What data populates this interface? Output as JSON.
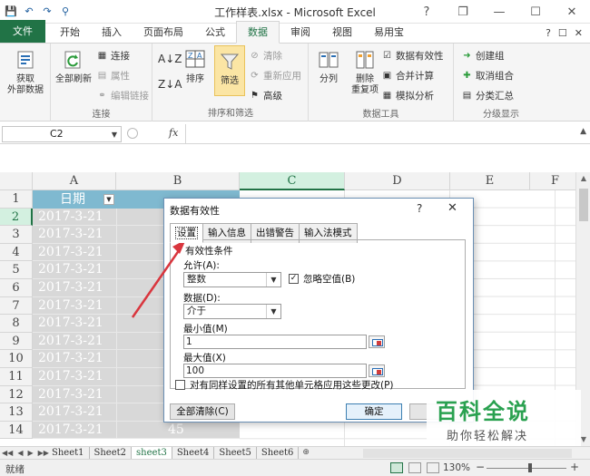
{
  "window": {
    "title": "工作样表.xlsx - Microsoft Excel",
    "qat": {
      "save": "💾",
      "undo": "↶",
      "redo": "↷",
      "custom": "⚲"
    },
    "controls": {
      "help": "?",
      "restore": "❐",
      "minimize": "—",
      "maximize": "☐",
      "close": "✕"
    }
  },
  "tabs": {
    "file": "文件",
    "items": [
      "开始",
      "插入",
      "页面布局",
      "公式",
      "数据",
      "审阅",
      "视图",
      "易用宝"
    ],
    "active": "数据",
    "right_icons": [
      "?",
      "☐",
      "✕"
    ]
  },
  "ribbon": {
    "get_external": {
      "label1": "获取",
      "label2": "外部数据"
    },
    "connections": {
      "refresh_all": "全部刷新",
      "connect": "连接",
      "properties": "属性",
      "edit_links": "编辑链接",
      "group": "连接"
    },
    "sort_filter": {
      "sort": "排序",
      "filter": "筛选",
      "clear": "清除",
      "reapply": "重新应用",
      "advanced": "高级",
      "group": "排序和筛选"
    },
    "data_tools": {
      "text_to_columns": "分列",
      "remove": "删除",
      "remove2": "重复项",
      "validation": "数据有效性",
      "consolidate": "合并计算",
      "whatif": "模拟分析",
      "group": "数据工具"
    },
    "outline": {
      "group_btn": "创建组",
      "ungroup": "取消组合",
      "subtotal": "分类汇总",
      "group": "分级显示"
    }
  },
  "formula_bar": {
    "name_box": "C2",
    "fx": "fx",
    "value": ""
  },
  "grid": {
    "columns": [
      "A",
      "B",
      "C",
      "D",
      "E",
      "F"
    ],
    "selected_column": "C",
    "rows": [
      "1",
      "2",
      "3",
      "4",
      "5",
      "6",
      "7",
      "8",
      "9",
      "10",
      "11",
      "12",
      "13",
      "14"
    ],
    "selected_row": "2",
    "header_a": "日期",
    "dates": [
      "2017-3-21",
      "2017-3-21",
      "2017-3-21",
      "2017-3-21",
      "2017-3-21",
      "2017-3-21",
      "2017-3-21",
      "2017-3-21",
      "2017-3-21",
      "2017-3-21",
      "2017-3-21",
      "2017-3-21",
      "2017-3-21"
    ],
    "b_last": "45"
  },
  "sheets": {
    "nav": [
      "◀◀",
      "◀",
      "▶",
      "▶▶"
    ],
    "items": [
      "Sheet1",
      "Sheet2",
      "sheet3",
      "Sheet4",
      "Sheet5",
      "Sheet6"
    ],
    "active": "sheet3"
  },
  "status": {
    "ready": "就绪",
    "zoom": "130%",
    "minus": "−",
    "plus": "+"
  },
  "dialog": {
    "title": "数据有效性",
    "help": "?",
    "close": "✕",
    "tabs": [
      "设置",
      "输入信息",
      "出错警告",
      "输入法模式"
    ],
    "active_tab": "设置",
    "section": "有效性条件",
    "allow_label": "允许(A):",
    "allow_value": "整数",
    "ignore_blank": "忽略空值(B)",
    "ignore_blank_checked": true,
    "data_label": "数据(D):",
    "data_value": "介于",
    "min_label": "最小值(M)",
    "min_value": "1",
    "max_label": "最大值(X)",
    "max_value": "100",
    "apply_all": "对有同样设置的所有其他单元格应用这些更改(P)",
    "clear_all": "全部清除(C)",
    "ok": "确定"
  },
  "watermark": {
    "main": "百科全说",
    "sub": "助你轻松解决"
  },
  "colors": {
    "accent": "#217346",
    "header_fill": "#7fb9d0",
    "arrow": "#d9363e",
    "filter_active": "#fbe5a4"
  }
}
